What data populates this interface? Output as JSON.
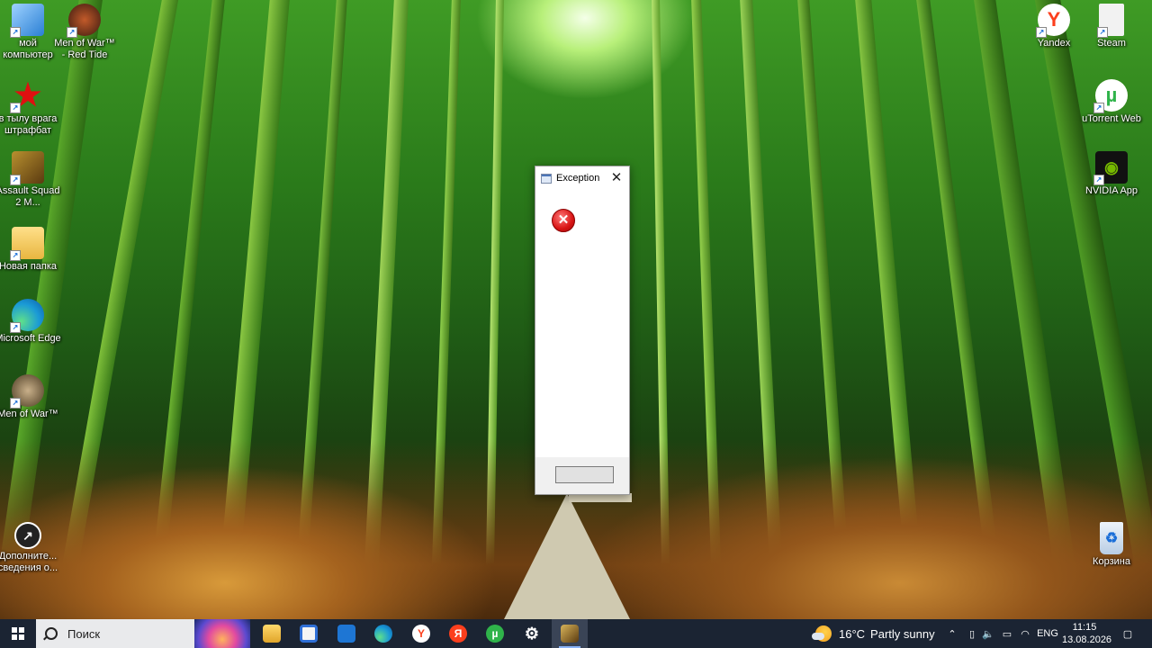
{
  "desktop": {
    "left_icons": [
      {
        "label": "мой компьютер",
        "icon": "computer-icon"
      },
      {
        "label": "Men of War™ - Red Tide",
        "icon": "game-icon"
      },
      {
        "label": "в тылу врага штрафбат",
        "icon": "red-star-icon"
      },
      {
        "label": "Assault Squad 2 M...",
        "icon": "game-icon"
      },
      {
        "label": "Новая папка",
        "icon": "folder-icon"
      },
      {
        "label": "Microsoft Edge",
        "icon": "edge-icon"
      },
      {
        "label": "Men of War™",
        "icon": "game-icon"
      },
      {
        "label": "Дополните... сведения о...",
        "icon": "info-icon"
      }
    ],
    "right_icons": [
      {
        "label": "Yandex",
        "icon": "yandex-browser-icon"
      },
      {
        "label": "Steam",
        "icon": "file-icon"
      },
      {
        "label": "uTorrent Web",
        "icon": "utorrent-icon"
      },
      {
        "label": "NVIDIA App",
        "icon": "nvidia-icon"
      },
      {
        "label": "Корзина",
        "icon": "recycle-bin-icon"
      }
    ]
  },
  "dialog": {
    "title": "Exception",
    "close_glyph": "✕",
    "error_glyph": "✕",
    "button_label": ""
  },
  "taskbar": {
    "search_placeholder": "Поиск",
    "pinned_apps": [
      {
        "name": "File Explorer",
        "icon": "file-explorer-icon",
        "glyph": "",
        "color": "#f2c14e"
      },
      {
        "name": "Microsoft Store",
        "icon": "store-icon",
        "glyph": "",
        "color": "#2f6fd6"
      },
      {
        "name": "Mail",
        "icon": "mail-icon",
        "glyph": "",
        "color": "#1e76d4"
      },
      {
        "name": "Microsoft Edge",
        "icon": "edge-icon",
        "glyph": "",
        "color": "#1aa3c9"
      },
      {
        "name": "Yandex Browser",
        "icon": "yandex-browser-icon",
        "glyph": "Y",
        "color": "#ffffff"
      },
      {
        "name": "Yandex",
        "icon": "yandex-icon",
        "glyph": "Я",
        "color": "#fc3f1d"
      },
      {
        "name": "uTorrent",
        "icon": "utorrent-icon",
        "glyph": "µ",
        "color": "#2fb34a"
      },
      {
        "name": "Settings",
        "icon": "settings-icon",
        "glyph": "⚙",
        "color": "#1b2433"
      },
      {
        "name": "Game",
        "icon": "game-icon",
        "glyph": "",
        "color": "#b08b3a"
      }
    ],
    "weather": {
      "temp": "16°C",
      "condition": "Partly sunny"
    },
    "language": "ENG",
    "time": "11:15",
    "date": "13.08.2026"
  },
  "colors": {
    "taskbar_bg": "#1b2433",
    "dialog_error": "#d81414"
  }
}
